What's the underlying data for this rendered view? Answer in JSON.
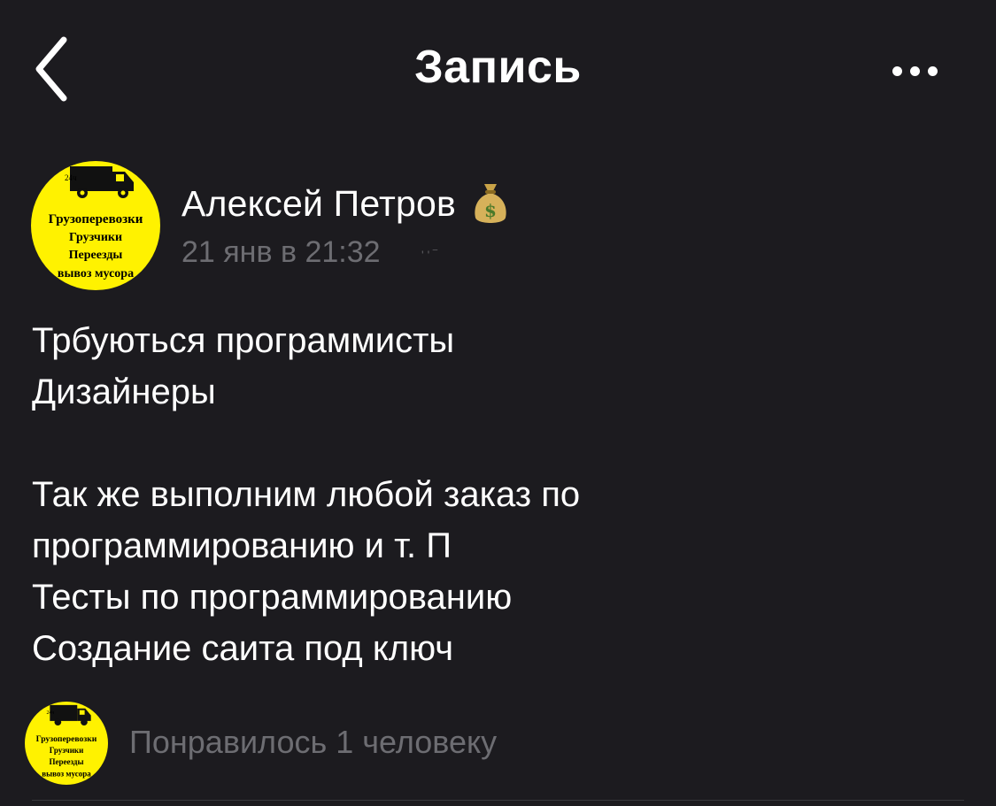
{
  "nav": {
    "title": "Запись"
  },
  "post": {
    "author": "Алексей Петров",
    "author_badge": "money-bag-icon",
    "date": "21 янв в 21:32",
    "lines": [
      "Трбуються программисты",
      "Дизайнеры",
      "",
      "Так же выполним любой заказ по",
      "программированию и т. П",
      "Тесты по программированию",
      "Создание саита под ключ"
    ]
  },
  "avatar": {
    "badge": "24ч",
    "lines": [
      "Грузоперевозки",
      "Грузчики",
      "Переезды",
      "вывоз мусора"
    ],
    "colors": {
      "background": "#fff200",
      "text": "#000000"
    }
  },
  "likes": {
    "text": "Понравилось 1 человеку"
  },
  "colors": {
    "background": "#1c1b1f",
    "text_primary": "#ffffff",
    "text_secondary": "#6d6d72"
  }
}
